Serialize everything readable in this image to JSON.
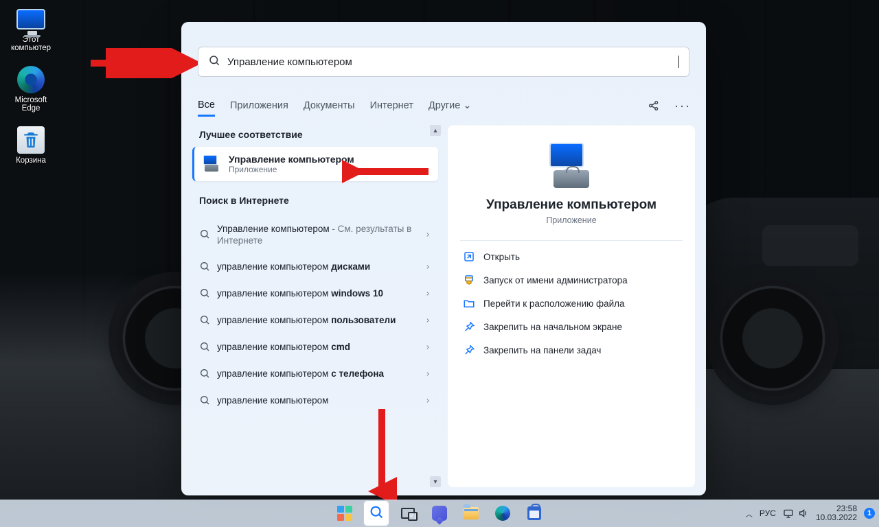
{
  "desktop": {
    "icons": [
      {
        "label": "Этот\nкомпьютер"
      },
      {
        "label": "Microsoft\nEdge"
      },
      {
        "label": "Корзина"
      }
    ]
  },
  "search": {
    "query": "Управление компьютером",
    "tabs": {
      "all": "Все",
      "apps": "Приложения",
      "docs": "Документы",
      "web": "Интернет",
      "more": "Другие"
    },
    "best_title": "Лучшее соответствие",
    "best_match": {
      "title": "Управление компьютером",
      "subtitle": "Приложение"
    },
    "web_title": "Поиск в Интернете",
    "web_items": [
      {
        "q": "Управление компьютером",
        "suffix": " - См. результаты в Интернете",
        "is_hint": true
      },
      {
        "prefix": "управление компьютером ",
        "bold": "дисками"
      },
      {
        "prefix": "управление компьютером ",
        "bold": "windows 10"
      },
      {
        "prefix": "управление компьютером ",
        "bold": "пользователи"
      },
      {
        "prefix": "управление компьютером ",
        "bold": "cmd"
      },
      {
        "prefix": "управление компьютером ",
        "bold": "с телефона"
      },
      {
        "prefix": "управление компьютером",
        "bold": ""
      }
    ],
    "details": {
      "title": "Управление компьютером",
      "subtitle": "Приложение",
      "actions": {
        "open": "Открыть",
        "run_admin": "Запуск от имени администратора",
        "open_location": "Перейти к расположению файла",
        "pin_start": "Закрепить на начальном экране",
        "pin_taskbar": "Закрепить на панели задач"
      }
    }
  },
  "tray": {
    "up": "^",
    "lang": "РУС",
    "time": "23:58",
    "date": "10.03.2022",
    "notif": "1"
  }
}
